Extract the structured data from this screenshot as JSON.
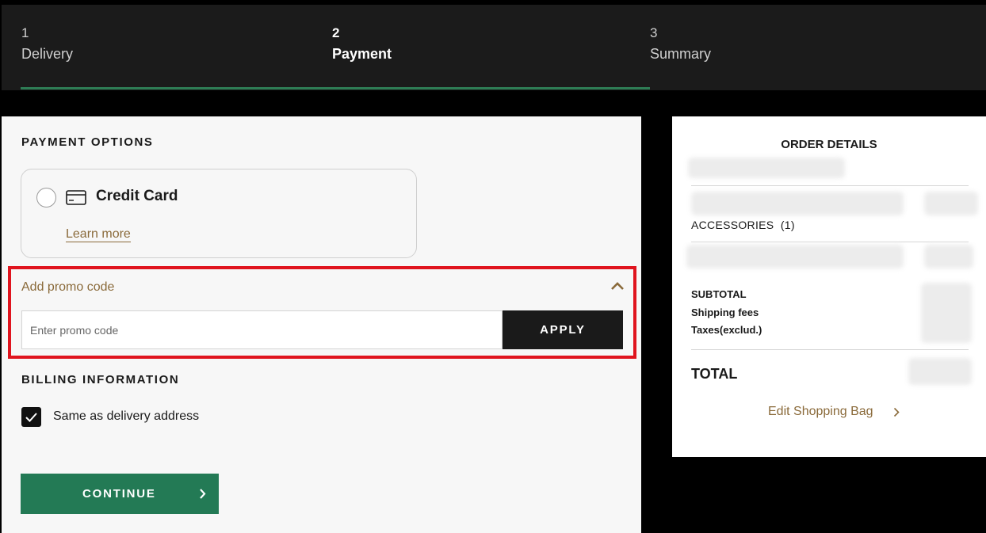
{
  "stepper": {
    "steps": [
      {
        "number": "1",
        "label": "Delivery"
      },
      {
        "number": "2",
        "label": "Payment"
      },
      {
        "number": "3",
        "label": "Summary"
      }
    ],
    "active_step": 2,
    "accent_color": "#2e7d55"
  },
  "payment": {
    "title": "PAYMENT OPTIONS",
    "credit_card": {
      "label": "Credit Card",
      "learn_more": "Learn more",
      "icon": "credit-card-icon"
    }
  },
  "promo": {
    "title": "Add promo code",
    "placeholder": "Enter promo code",
    "apply_label": "APPLY",
    "highlight_color": "#e0141e"
  },
  "billing": {
    "title": "BILLING INFORMATION",
    "same_as_delivery": "Same as delivery address",
    "same_as_delivery_checked": true
  },
  "continue_label": "CONTINUE",
  "order": {
    "title": "ORDER DETAILS",
    "accessories_label": "ACCESSORIES",
    "accessories_count": "(1)",
    "subtotal_label": "SUBTOTAL",
    "shipping_label": "Shipping fees",
    "taxes_label": "Taxes(exclud.)",
    "total_label": "TOTAL",
    "edit_bag_label": "Edit Shopping Bag"
  },
  "colors": {
    "brand_gold": "#8a6a3a",
    "continue_green": "#237a55",
    "dark": "#1a1a1a"
  }
}
